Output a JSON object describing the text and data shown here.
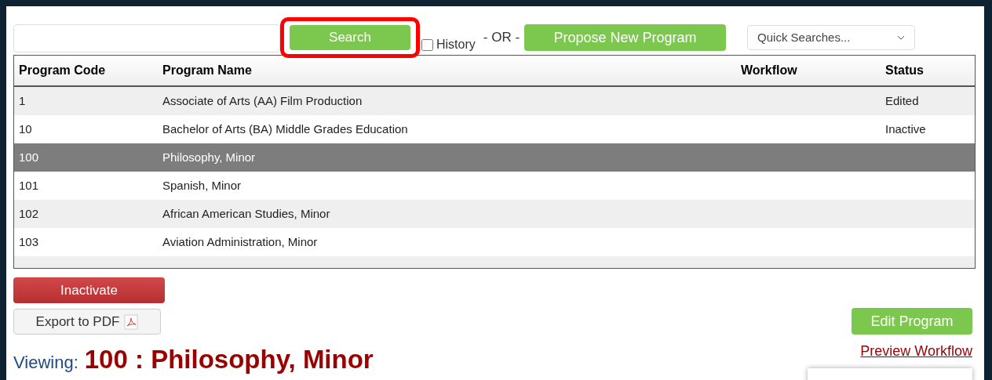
{
  "search": {
    "button": "Search",
    "highlighted": true,
    "history": {
      "label": "History",
      "checked": false
    },
    "or": "- OR -",
    "propose": "Propose New Program",
    "quick": "Quick Searches..."
  },
  "table": {
    "columns": [
      "Program Code",
      "Program Name",
      "Workflow",
      "Status"
    ],
    "rows": [
      {
        "code": "1",
        "name": "Associate of Arts (AA) Film Production",
        "workflow": "",
        "status": "Edited",
        "selected": false
      },
      {
        "code": "10",
        "name": "Bachelor of Arts (BA) Middle Grades Education",
        "workflow": "",
        "status": "Inactive",
        "selected": false
      },
      {
        "code": "100",
        "name": "Philosophy, Minor",
        "workflow": "",
        "status": "",
        "selected": true
      },
      {
        "code": "101",
        "name": "Spanish, Minor",
        "workflow": "",
        "status": "",
        "selected": false
      },
      {
        "code": "102",
        "name": "African American Studies, Minor",
        "workflow": "",
        "status": "",
        "selected": false
      },
      {
        "code": "103",
        "name": "Aviation Administration, Minor",
        "workflow": "",
        "status": "",
        "selected": false
      }
    ]
  },
  "actions": {
    "inactivate": "Inactivate",
    "export": "Export to PDF",
    "edit": "Edit Program",
    "preview": "Preview Workflow"
  },
  "viewing": {
    "label": "Viewing:",
    "title": "100 : Philosophy, Minor"
  }
}
